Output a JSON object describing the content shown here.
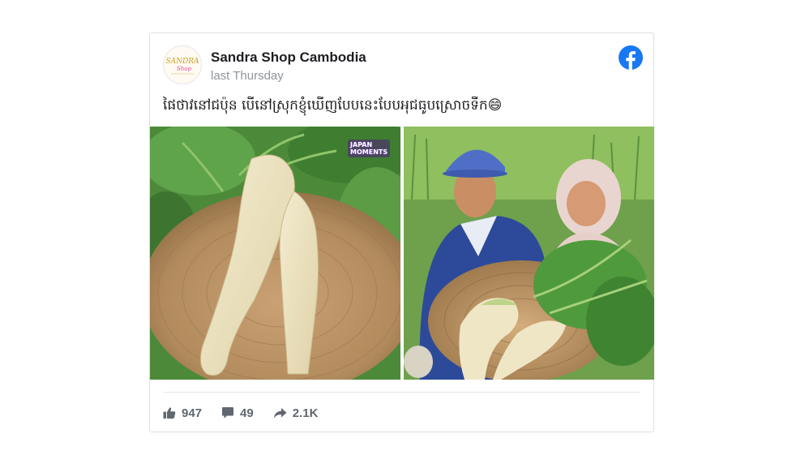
{
  "post": {
    "page_name": "Sandra Shop Cambodia",
    "timestamp": "last Thursday",
    "caption": "ផៃថាវនៅជប៉ុន បើនៅស្រុកខ្ញុំឃើញបែបនេះបែបអុជធូបស្រោចទឹក😄",
    "avatar_icon": "sandra-shop-logo",
    "brand_icon": "facebook-icon",
    "brand_color": "#1877f2"
  },
  "media": {
    "left_photo": "radish-shaped-like-legs-on-basket",
    "left_watermark_line1": "JAPAN",
    "left_watermark_line2": "MOMENTS",
    "right_photo": "elderly-couple-holding-radish-basket"
  },
  "stats": {
    "likes": "947",
    "comments": "49",
    "shares": "2.1K",
    "like_icon": "thumbs-up-icon",
    "comment_icon": "comment-icon",
    "share_icon": "share-arrow-icon"
  }
}
